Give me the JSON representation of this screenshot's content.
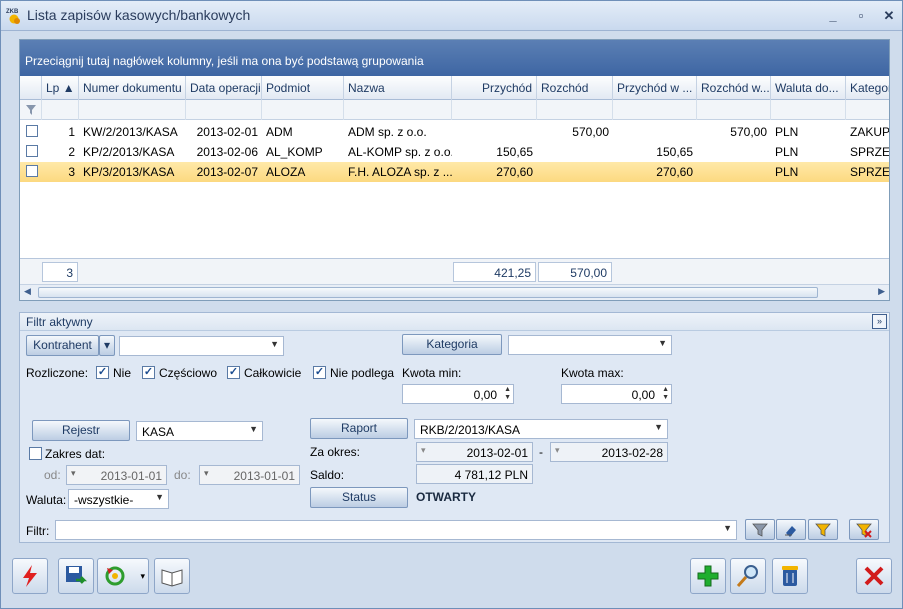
{
  "window": {
    "title": "Lista zapisów kasowych/bankowych",
    "app_badge": "ZKB"
  },
  "grid": {
    "group_hint": "Przeciągnij tutaj nagłówek kolumny, jeśli ma ona być podstawą grupowania",
    "columns": [
      "Lp",
      "Numer dokumentu",
      "Data operacji",
      "Podmiot",
      "Nazwa",
      "Przychód",
      "Rozchód",
      "Przychód w ...",
      "Rozchód w...",
      "Waluta do...",
      "Kategor"
    ],
    "rows": [
      {
        "lp": "1",
        "doc": "KW/2/2013/KASA",
        "date": "2013-02-01",
        "subject": "ADM",
        "name": "ADM sp. z o.o.",
        "income": "",
        "expense": "570,00",
        "income_cur": "",
        "expense_cur": "570,00",
        "currency": "PLN",
        "category": "ZAKUPY"
      },
      {
        "lp": "2",
        "doc": "KP/2/2013/KASA",
        "date": "2013-02-06",
        "subject": "AL_KOMP",
        "name": "AL-KOMP sp. z o.o.",
        "income": "150,65",
        "expense": "",
        "income_cur": "150,65",
        "expense_cur": "",
        "currency": "PLN",
        "category": "SPRZED"
      },
      {
        "lp": "3",
        "doc": "KP/3/2013/KASA",
        "date": "2013-02-07",
        "subject": "ALOZA",
        "name": "F.H. ALOZA sp. z ...",
        "income": "270,60",
        "expense": "",
        "income_cur": "270,60",
        "expense_cur": "",
        "currency": "PLN",
        "category": "SPRZED"
      }
    ],
    "footer": {
      "count": "3",
      "income_sum": "421,25",
      "expense_sum": "570,00"
    }
  },
  "filter": {
    "title": "Filtr aktywny",
    "kontrahent_label": "Kontrahent",
    "kontrahent_value": "",
    "kategoria_label": "Kategoria",
    "kategoria_value": "",
    "rozliczone_label": "Rozliczone:",
    "opt_nie": "Nie",
    "opt_czesciowo": "Częściowo",
    "opt_calkowicie": "Całkowicie",
    "opt_nie_podlega": "Nie podlega",
    "kwota_min_label": "Kwota min:",
    "kwota_min": "0,00",
    "kwota_max_label": "Kwota max:",
    "kwota_max": "0,00",
    "rejestr_label": "Rejestr",
    "rejestr_value": "KASA",
    "zakres_label": "Zakres dat:",
    "od_label": "od:",
    "od_value": "2013-01-01",
    "do_label": "do:",
    "do_value": "2013-01-01",
    "waluta_label": "Waluta:",
    "waluta_value": "-wszystkie-",
    "raport_label": "Raport",
    "raport_value": "RKB/2/2013/KASA",
    "za_okres_label": "Za okres:",
    "okres_od": "2013-02-01",
    "okres_sep": "-",
    "okres_do": "2013-02-28",
    "saldo_label": "Saldo:",
    "saldo_value": "4 781,12 PLN",
    "status_label": "Status",
    "status_value": "OTWARTY",
    "filtr_label": "Filtr:",
    "filtr_value": ""
  }
}
